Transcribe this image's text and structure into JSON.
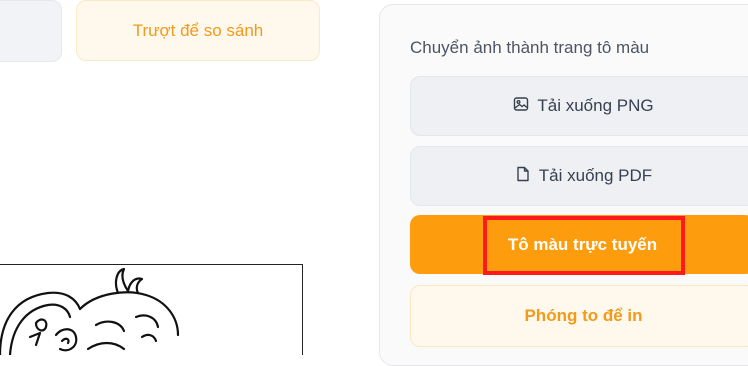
{
  "compare_button": {
    "label": "Trượt để so sánh"
  },
  "panel": {
    "title": "Chuyển ảnh thành trang tô màu",
    "download_png": {
      "label": "Tải xuống PNG",
      "icon": "image-icon"
    },
    "download_pdf": {
      "label": "Tải xuống PDF",
      "icon": "file-icon"
    },
    "color_online": {
      "label": "Tô màu trực tuyến"
    },
    "zoom_print": {
      "label": "Phóng to để in"
    }
  },
  "colors": {
    "accent": "#fd9c0c",
    "accent_text": "#f29a1a",
    "highlight": "#ff1a1a"
  }
}
